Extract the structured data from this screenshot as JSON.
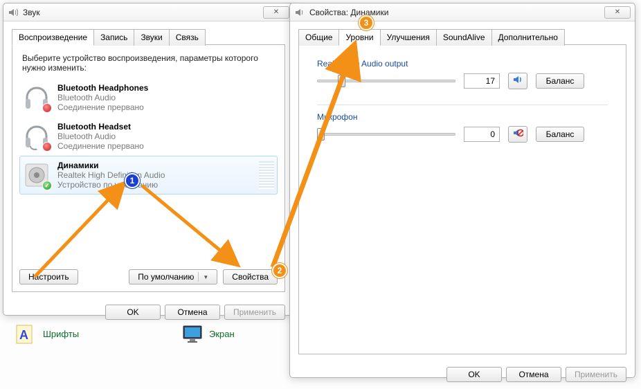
{
  "sound_window": {
    "title": "Звук",
    "tabs": [
      "Воспроизведение",
      "Запись",
      "Звуки",
      "Связь"
    ],
    "active_tab": 0,
    "instruction": "Выберите устройство воспроизведения, параметры которого нужно изменить:",
    "devices": [
      {
        "name": "Bluetooth Headphones",
        "driver": "Bluetooth Audio",
        "status": "Соединение прервано",
        "badge": "red"
      },
      {
        "name": "Bluetooth Headset",
        "driver": "Bluetooth Audio",
        "status": "Соединение прервано",
        "badge": "red"
      },
      {
        "name": "Динамики",
        "driver": "Realtek High Definition Audio",
        "status": "Устройство по умолчанию",
        "badge": "green",
        "selected": true
      }
    ],
    "buttons": {
      "configure": "Настроить",
      "default": "По умолчанию",
      "properties": "Свойства"
    },
    "dlg": {
      "ok": "OK",
      "cancel": "Отмена",
      "apply": "Применить"
    }
  },
  "prop_window": {
    "title": "Свойства: Динамики",
    "tabs": [
      "Общие",
      "Уровни",
      "Улучшения",
      "SoundAlive",
      "Дополнительно"
    ],
    "active_tab": 1,
    "output": {
      "label": "Realtek HD Audio output",
      "value": "17",
      "balance": "Баланс"
    },
    "mic": {
      "label": "Микрофон",
      "value": "0",
      "balance": "Баланс"
    },
    "dlg": {
      "ok": "OK",
      "cancel": "Отмена",
      "apply": "Применить"
    }
  },
  "desktop": {
    "fonts": "Шрифты",
    "screen": "Экран"
  },
  "markers": {
    "m1": "1",
    "m2": "2",
    "m3": "3"
  },
  "colors": {
    "arrow": "#f39018"
  }
}
